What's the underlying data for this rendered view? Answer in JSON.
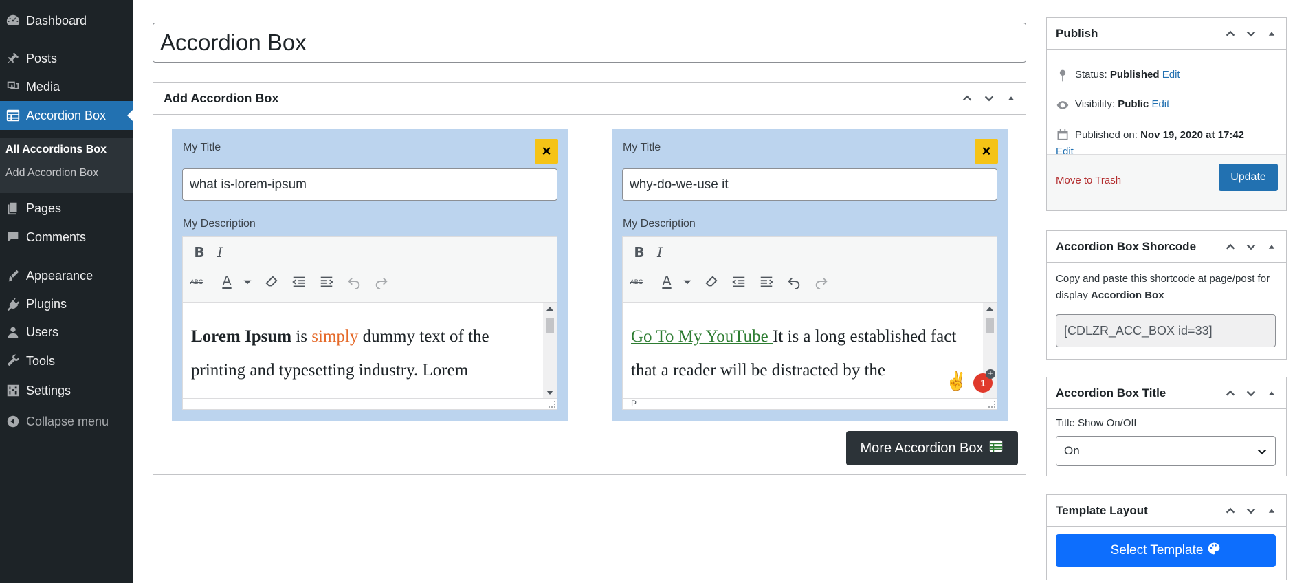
{
  "sidebar": {
    "items": [
      {
        "label": "Dashboard",
        "icon": "dashboard-icon"
      },
      {
        "label": "Posts",
        "icon": "pin-icon"
      },
      {
        "label": "Media",
        "icon": "media-icon"
      },
      {
        "label": "Accordion Box",
        "icon": "table-icon"
      },
      {
        "label": "Pages",
        "icon": "pages-icon"
      },
      {
        "label": "Comments",
        "icon": "comments-icon"
      },
      {
        "label": "Appearance",
        "icon": "appearance-icon"
      },
      {
        "label": "Plugins",
        "icon": "plugins-icon"
      },
      {
        "label": "Users",
        "icon": "users-icon"
      },
      {
        "label": "Tools",
        "icon": "tools-icon"
      },
      {
        "label": "Settings",
        "icon": "settings-icon"
      },
      {
        "label": "Collapse menu",
        "icon": "collapse-icon"
      }
    ],
    "submenu": [
      "All Accordions Box",
      "Add Accordion Box"
    ]
  },
  "post_title": "Accordion Box",
  "main_box": {
    "title": "Add Accordion Box",
    "cards": [
      {
        "title_label": "My Title",
        "title_value": "what is-lorem-ipsum",
        "desc_label": "My Description",
        "content": {
          "bold": "Lorem Ipsum",
          "plain1": " is ",
          "orange": "simply",
          "plain2": " dummy text of the printing and typesetting industry. Lorem"
        },
        "status": ""
      },
      {
        "title_label": "My Title",
        "title_value": "why-do-we-use it",
        "desc_label": "My Description",
        "content": {
          "link": "Go To My YouTube ",
          "plain": "It is a long established fact that a reader will be distracted by the"
        },
        "status": "P"
      }
    ],
    "close_symbol": "×",
    "toolbar": {
      "bold": "B",
      "italic": "I",
      "strike": "ABC",
      "color": "A"
    },
    "more_button": "More Accordion Box",
    "notification_count": "1",
    "emoji": "✌️"
  },
  "publish": {
    "title": "Publish",
    "status_label": "Status:",
    "status_value": "Published",
    "visibility_label": "Visibility:",
    "visibility_value": "Public",
    "published_label": "Published on:",
    "published_value": "Nov 19, 2020 at 17:42",
    "edit": "Edit",
    "trash": "Move to Trash",
    "update": "Update"
  },
  "shortcode": {
    "title": "Accordion Box Shorcode",
    "text_prefix": "Copy and paste this shortcode at page/post for display ",
    "text_bold": "Accordion Box",
    "value": "[CDLZR_ACC_BOX id=33]"
  },
  "title_box": {
    "title": "Accordion Box Title",
    "label": "Title Show On/Off",
    "selected": "On"
  },
  "template_box": {
    "title": "Template Layout",
    "button": "Select Template"
  },
  "colors": {
    "sidebar": "#1d2327",
    "accent": "#2271b1",
    "card": "#bcd4ee",
    "close": "#f5c316",
    "template": "#0d6efd"
  }
}
